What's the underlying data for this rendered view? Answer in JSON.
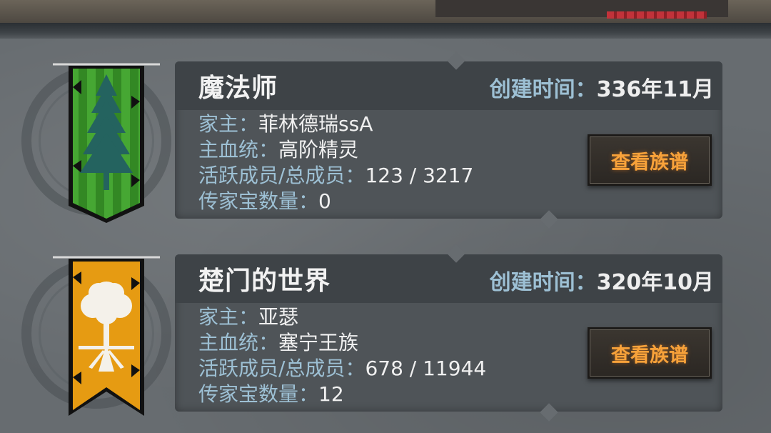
{
  "houses": [
    {
      "name": "魔法师",
      "founded_label": "创建时间：",
      "founded_value": "336年11月",
      "head_label": "家主：",
      "head_value": "菲林德瑞ssA",
      "bloodline_label": "主血统：",
      "bloodline_value": "高阶精灵",
      "members_label": "活跃成员/总成员：",
      "members_value": "123 / 3217",
      "heirlooms_label": "传家宝数量：",
      "heirlooms_value": "0",
      "button_label": "查看族谱",
      "banner_color": "#3f9a2e",
      "banner_icon": "pine-tree-icon"
    },
    {
      "name": "楚门的世界",
      "founded_label": "创建时间：",
      "founded_value": "320年10月",
      "head_label": "家主：",
      "head_value": "亚瑟",
      "bloodline_label": "主血统：",
      "bloodline_value": "塞宁王族",
      "members_label": "活跃成员/总成员：",
      "members_value": "678 / 11944",
      "heirlooms_label": "传家宝数量：",
      "heirlooms_value": "12",
      "button_label": "查看族谱",
      "banner_color": "#e69b12",
      "banner_icon": "white-tree-icon"
    }
  ]
}
